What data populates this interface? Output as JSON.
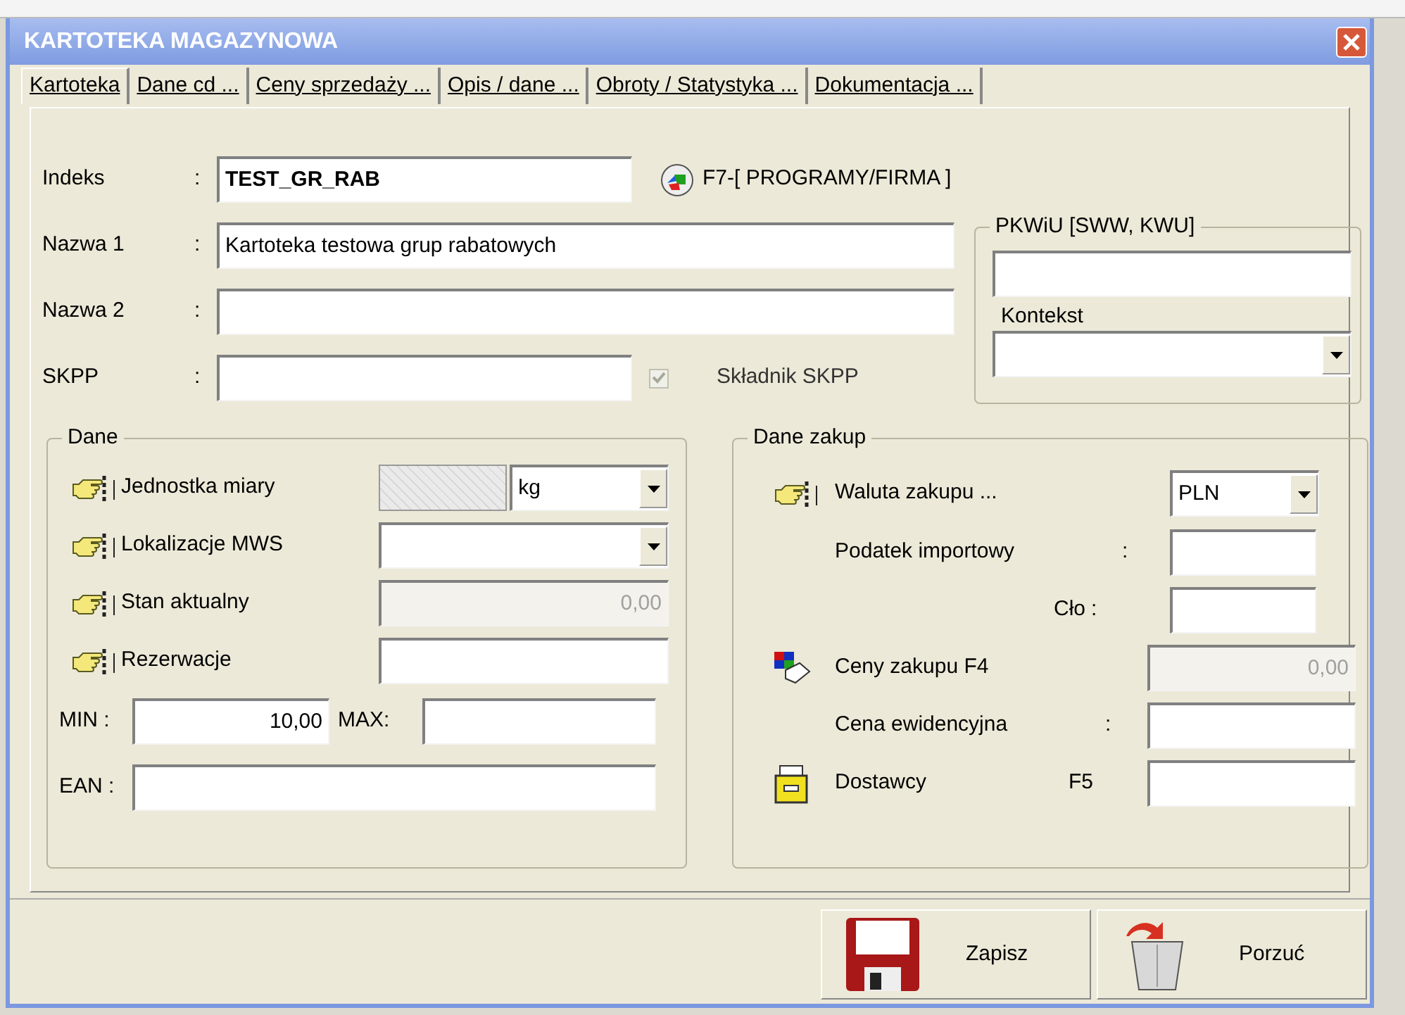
{
  "window": {
    "title": "KARTOTEKA MAGAZYNOWA"
  },
  "tabs": [
    {
      "label": "Kartoteka",
      "selected": true
    },
    {
      "label": "Dane cd ...",
      "selected": false
    },
    {
      "label": "Ceny sprzedaży ...",
      "selected": false
    },
    {
      "label": "Opis / dane ...",
      "selected": false
    },
    {
      "label": "Obroty / Statystyka ...",
      "selected": false
    },
    {
      "label": "Dokumentacja ...",
      "selected": false
    }
  ],
  "header": {
    "indeks": {
      "label": "Indeks",
      "separator": ":",
      "value": "TEST_GR_RAB"
    },
    "program_link": "F7-[ PROGRAMY/FIRMA ]",
    "nazwa_1": {
      "label": "Nazwa 1",
      "separator": ":",
      "value": "Kartoteka testowa grup rabatowych"
    },
    "nazwa_2": {
      "label": "Nazwa 2",
      "separator": ":"
    },
    "skpp": {
      "label": "SKPP",
      "separator": ":"
    },
    "skladnik_skpp": {
      "label": "Składnik SKPP",
      "checked": true,
      "disabled": true
    }
  },
  "pkwiu": {
    "legend": "PKWiU [SWW, KWU]",
    "kontekst_label": "Kontekst"
  },
  "dane": {
    "legend": "Dane",
    "rows": [
      {
        "kind": "unit",
        "label": "Jednostka miary",
        "value": "kg"
      },
      {
        "kind": "select",
        "label": "Lokalizacje MWS"
      },
      {
        "kind": "input",
        "label": "Stan aktualny",
        "value": "0,00",
        "disabled": true
      },
      {
        "kind": "input",
        "label": "Rezerwacje",
        "disabled": false
      }
    ],
    "min": {
      "label": "MIN :",
      "value": "10,00"
    },
    "max": {
      "label": "MAX:"
    },
    "ean": {
      "label": "EAN :"
    }
  },
  "dane_zakup": {
    "legend": "Dane zakup",
    "rows": [
      {
        "kind": "currency_select",
        "label": "Waluta zakupu ...",
        "value": "PLN"
      },
      {
        "kind": "short",
        "label": "Podatek importowy",
        "separator": ":",
        "disabled": false
      },
      {
        "kind": "short_right",
        "label": "Cło",
        "separator": ":",
        "disabled": false
      },
      {
        "kind": "prices",
        "label": "Ceny zakupu F4",
        "value": "0,00",
        "disabled": true
      },
      {
        "kind": "wide",
        "label": "Cena ewidencyjna",
        "separator": ":",
        "disabled": false
      },
      {
        "kind": "suppliers",
        "label": "Dostawcy",
        "suffix": "F5",
        "disabled": false
      }
    ]
  },
  "buttons": [
    {
      "kind": "save",
      "label": "Zapisz"
    },
    {
      "kind": "discard",
      "label": "Porzuć"
    }
  ]
}
